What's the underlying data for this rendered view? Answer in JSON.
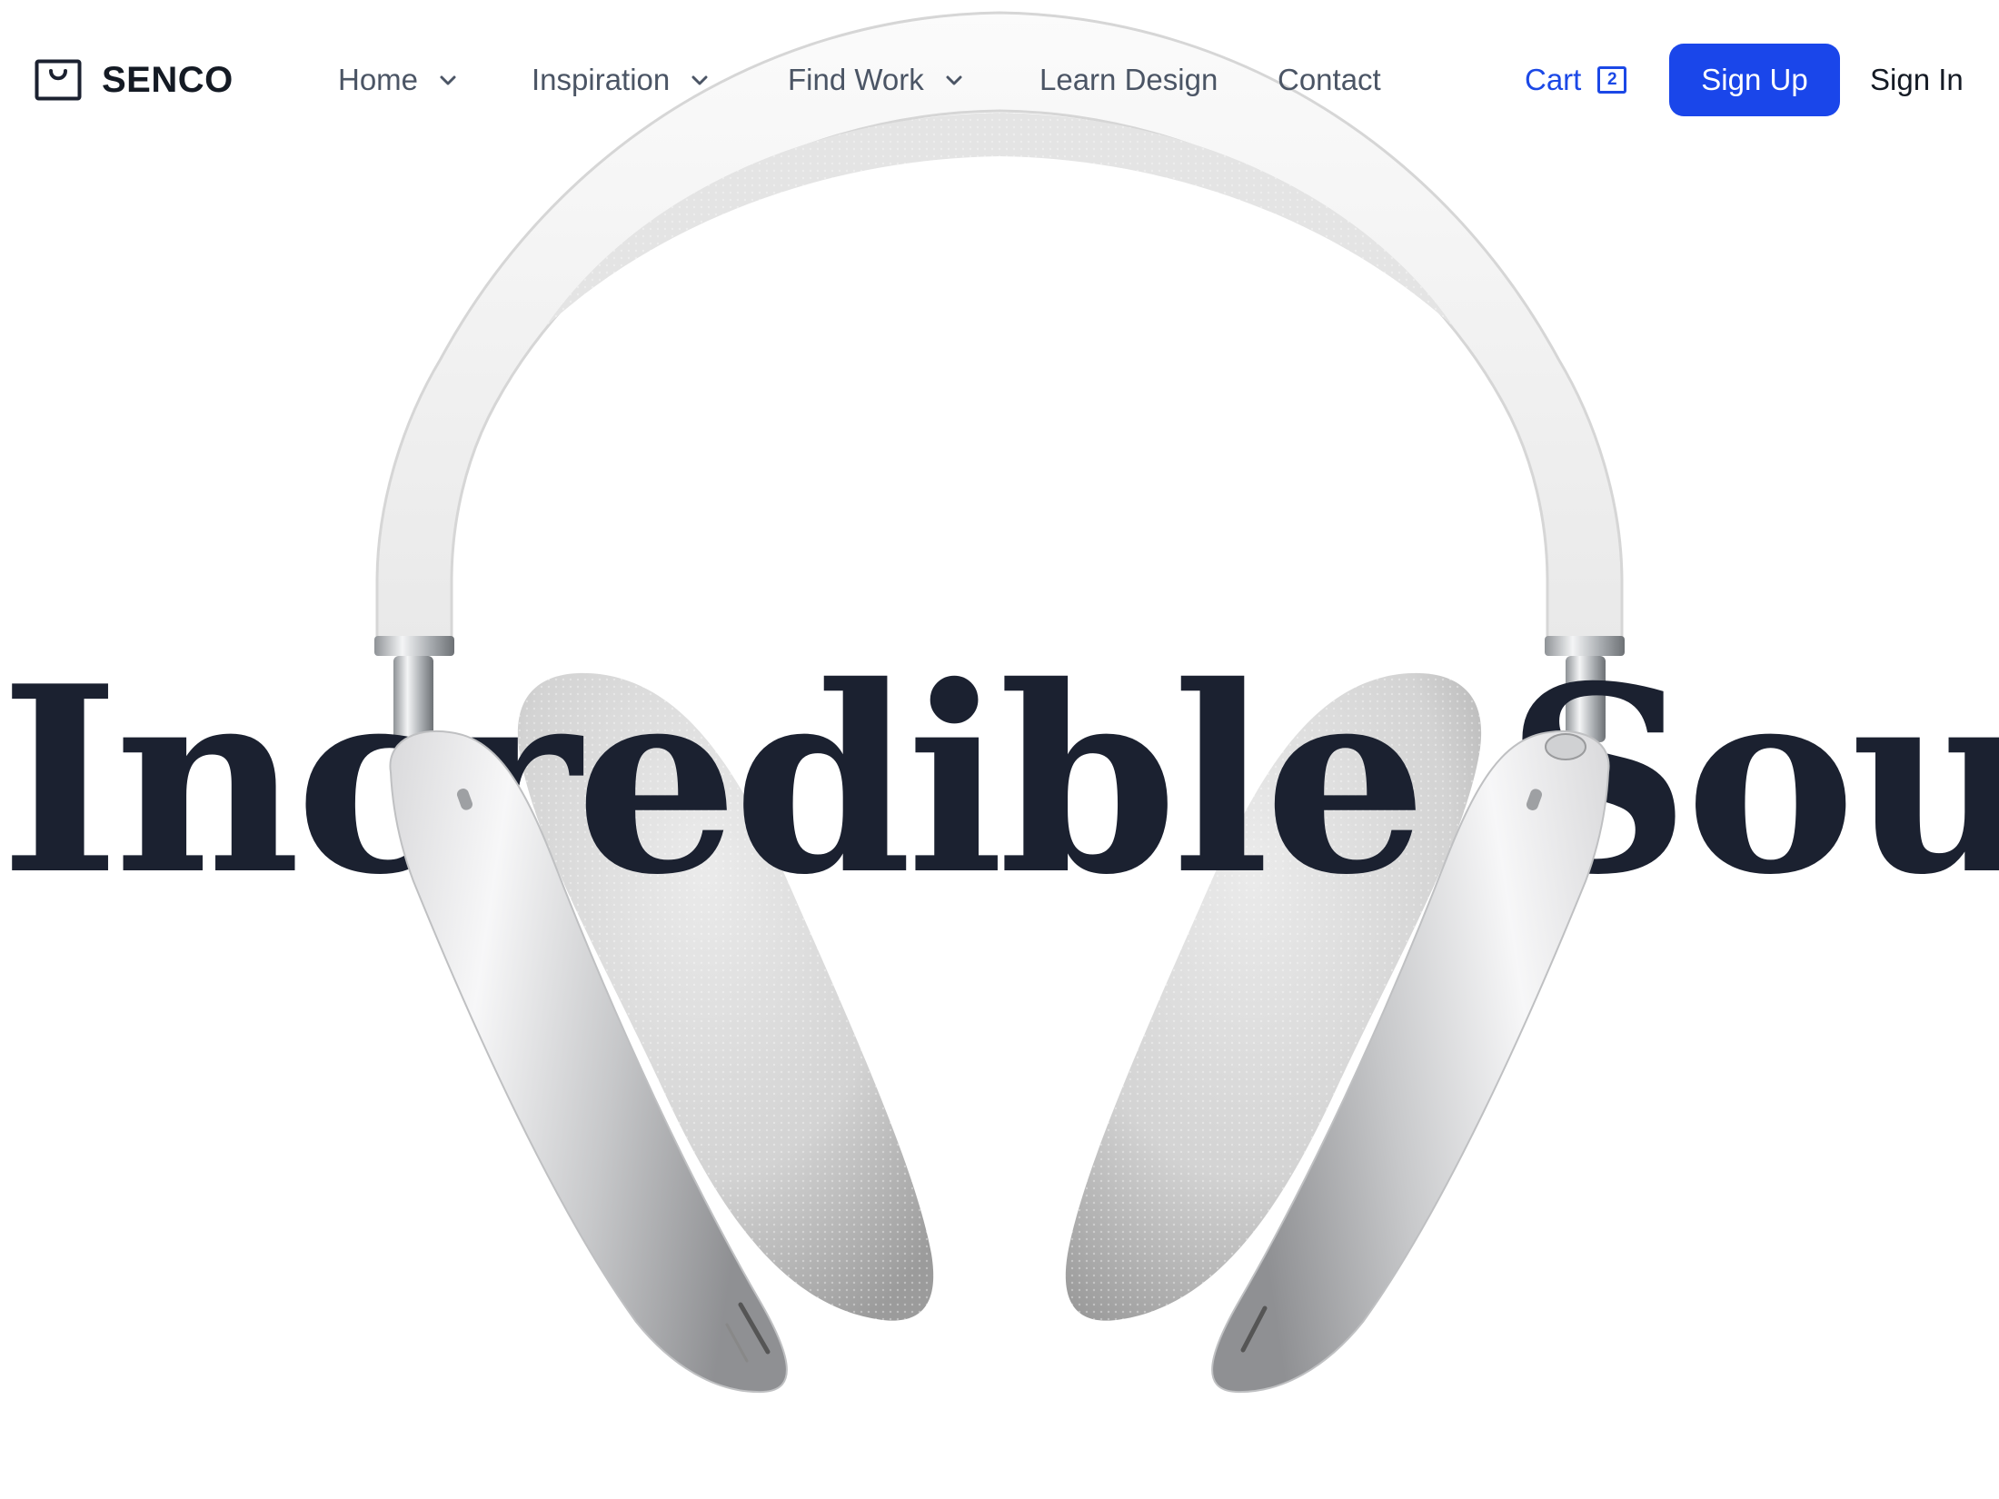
{
  "brand": {
    "name": "SENCO",
    "icon": "shopping-bag-icon"
  },
  "nav": {
    "items": [
      {
        "label": "Home",
        "has_dropdown": true
      },
      {
        "label": "Inspiration",
        "has_dropdown": true
      },
      {
        "label": "Find Work",
        "has_dropdown": true
      },
      {
        "label": "Learn Design",
        "has_dropdown": false
      },
      {
        "label": "Contact",
        "has_dropdown": false
      }
    ],
    "dropdown_icon": "chevron-down-icon"
  },
  "cart": {
    "label": "Cart",
    "count": "2"
  },
  "auth": {
    "signup_label": "Sign Up",
    "signin_label": "Sign In"
  },
  "hero": {
    "title": "Incredible Sound",
    "image": "over-ear-headphones"
  },
  "colors": {
    "accent": "#1a46ea",
    "text_dark": "#1b2130",
    "nav_text": "#4b5565",
    "background": "#ffffff"
  }
}
